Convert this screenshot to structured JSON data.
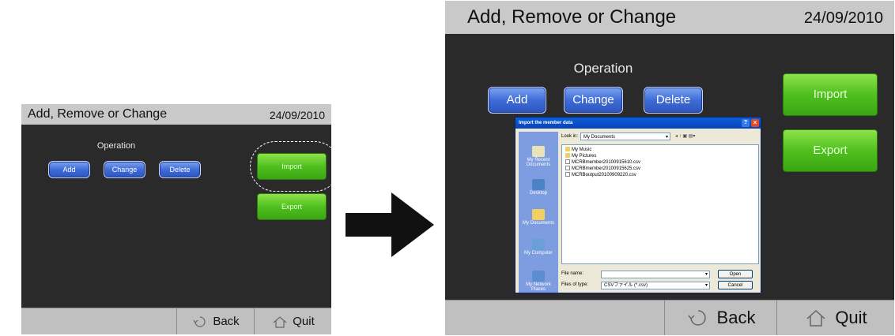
{
  "before": {
    "title": "Add, Remove or Change",
    "date": "24/09/2010",
    "operation_label": "Operation",
    "buttons": {
      "add": "Add",
      "change": "Change",
      "delete": "Delete",
      "import": "Import",
      "export": "Export"
    },
    "back": "Back",
    "quit": "Quit"
  },
  "after": {
    "title": "Add, Remove or Change",
    "date": "24/09/2010",
    "operation_label": "Operation",
    "buttons": {
      "add": "Add",
      "change": "Change",
      "delete": "Delete",
      "import": "Import",
      "export": "Export"
    },
    "back": "Back",
    "quit": "Quit",
    "dialog": {
      "title": "Import the member data",
      "look_in_label": "Look in:",
      "look_in_value": "My Documents",
      "places": [
        "My Recent Documents",
        "Desktop",
        "My Documents",
        "My Computer",
        "My Network Places"
      ],
      "files": [
        "My Music",
        "My Pictures",
        "MCRBmember20100915610.csv",
        "MCRBmember20100915625.csv",
        "MCRBoutput20100909220.csv"
      ],
      "file_name_label": "File name:",
      "file_name_value": "",
      "file_type_label": "Files of type:",
      "file_type_value": "CSVファイル (*.csv)",
      "open": "Open",
      "cancel": "Cancel"
    }
  },
  "colors": {
    "panel": "#2a2a2a",
    "titlebar": "#c9c9c9",
    "blue": "#3f6cd8",
    "green": "#4fc01f"
  }
}
